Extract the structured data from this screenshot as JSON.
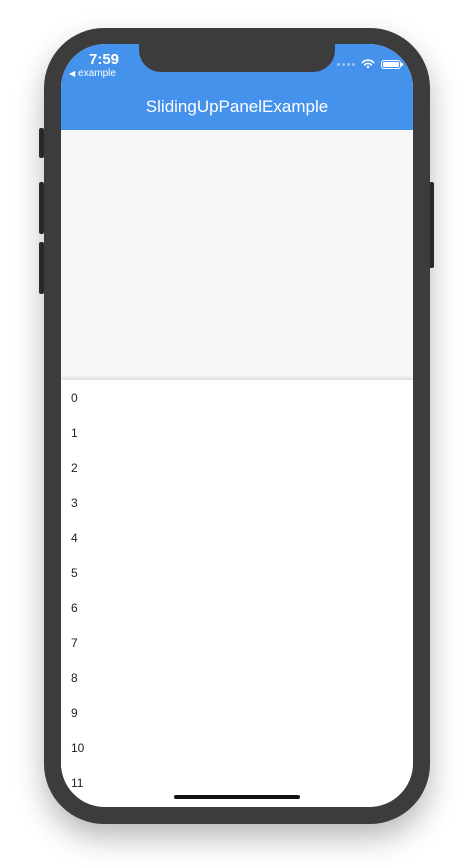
{
  "status_bar": {
    "time": "7:59",
    "back_app": "example"
  },
  "app_bar": {
    "title": "SlidingUpPanelExample",
    "color": "#4492ec"
  },
  "panel": {
    "items": [
      "0",
      "1",
      "2",
      "3",
      "4",
      "5",
      "6",
      "7",
      "8",
      "9",
      "10",
      "11"
    ]
  }
}
